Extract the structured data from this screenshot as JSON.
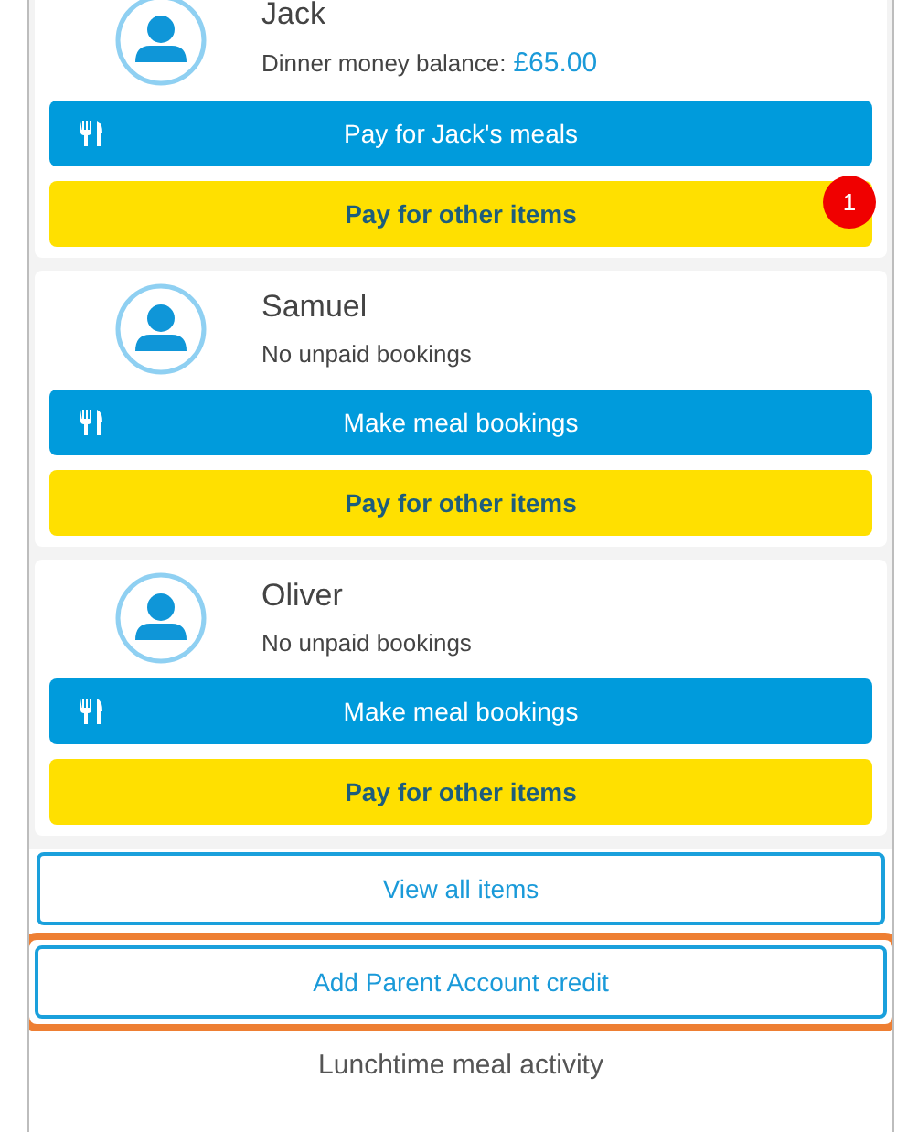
{
  "children": [
    {
      "name": "Jack",
      "status": "Dinner money balance:",
      "balance": "£65.00",
      "meal_button": "Pay for Jack's meals",
      "other_button": "Pay for other items",
      "badge": "1"
    },
    {
      "name": "Samuel",
      "status": "No unpaid bookings",
      "meal_button": "Make meal bookings",
      "other_button": "Pay for other items"
    },
    {
      "name": "Oliver",
      "status": "No unpaid bookings",
      "meal_button": "Make meal bookings",
      "other_button": "Pay for other items"
    }
  ],
  "actions": [
    {
      "label": "View all items",
      "highlighted": false
    },
    {
      "label": "Add Parent Account credit",
      "highlighted": true
    }
  ],
  "section_title": "Lunchtime meal activity"
}
